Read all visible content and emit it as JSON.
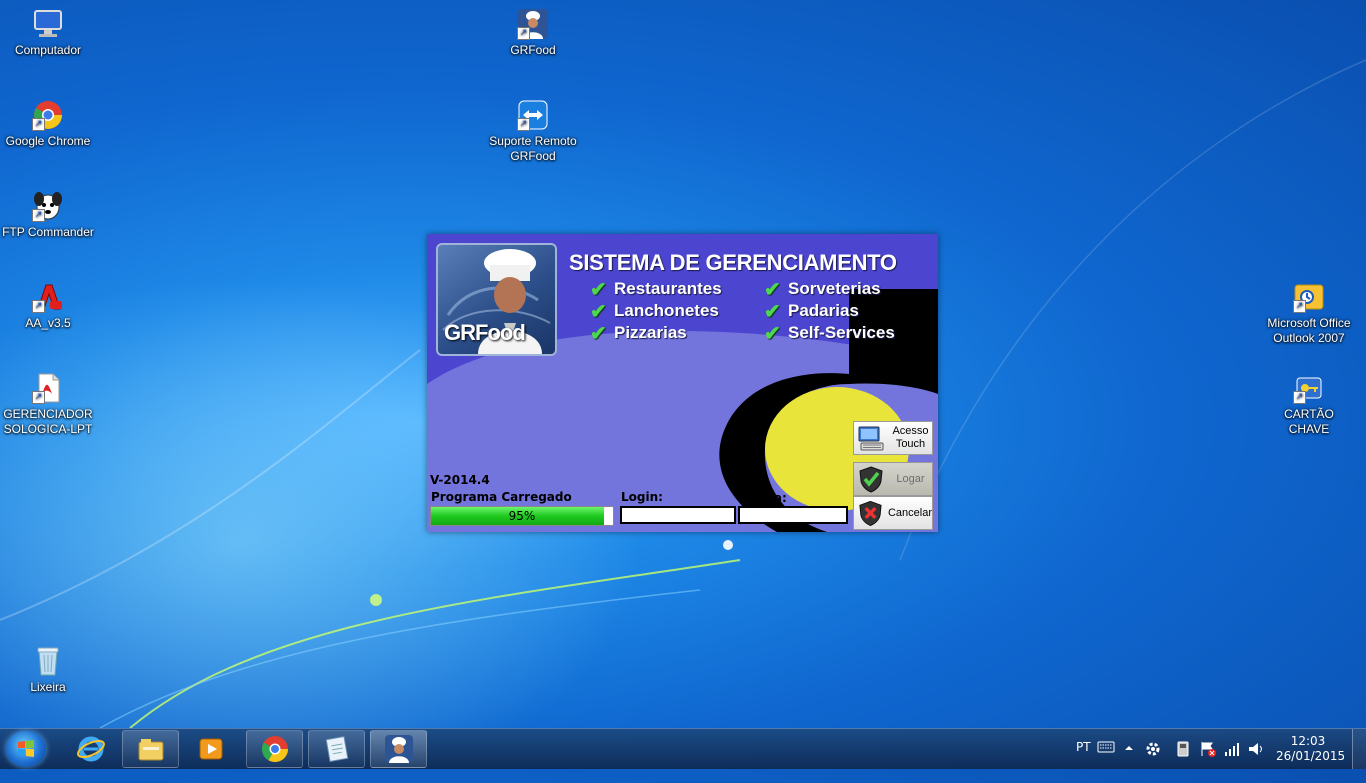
{
  "desktop": {
    "icons": [
      {
        "label": "Computador"
      },
      {
        "label": "Google Chrome"
      },
      {
        "label": "FTP Commander"
      },
      {
        "label": "AA_v3.5"
      },
      {
        "label": "GERENCIADOR\nSOLOGICA-LPT"
      },
      {
        "label": "Lixeira"
      },
      {
        "label": "GRFood"
      },
      {
        "label": "Suporte Remoto\nGRFood"
      },
      {
        "label": "Microsoft Office\nOutlook 2007"
      },
      {
        "label": "CARTÃO CHAVE"
      }
    ]
  },
  "app": {
    "logo_text": "GRFood",
    "title": "SISTEMA DE GERENCIAMENTO",
    "features_left": [
      "Restaurantes",
      "Lanchonetes",
      "Pizzarias"
    ],
    "features_right": [
      "Sorveterias",
      "Padarias",
      "Self-Services"
    ],
    "version": "V-2014.4",
    "status_label": "Programa Carregado",
    "progress": {
      "percent": 95,
      "text": "95%"
    },
    "login_label": "Login:",
    "login_value": "",
    "password_label": "Senha:",
    "password_value": "",
    "buttons": {
      "touch": "Acesso\nTouch",
      "login": "Logar",
      "cancel": "Cancelar"
    },
    "colors": {
      "background": "#4b45d0",
      "accent_yellow": "#e8e43a",
      "check": "#4ed64e"
    }
  },
  "taskbar": {
    "language": "PT",
    "time": "12:03",
    "date": "26/01/2015",
    "pinned": [
      "internet-explorer-icon",
      "windows-explorer-icon",
      "media-player-icon",
      "chrome-icon",
      "notepad-icon",
      "grfood-icon"
    ]
  }
}
